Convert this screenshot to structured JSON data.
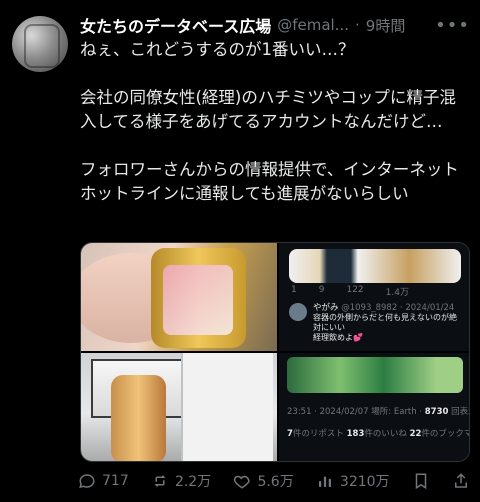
{
  "tweet": {
    "name": "女たちのデータベース広場",
    "handle": "@femal...",
    "dot": "·",
    "time": "9時間",
    "text": "ねぇ、これどうするのが1番いい…？\n\n会社の同僚女性(経理)のハチミツやコップに精子混入してる様子をあげてるアカウントなんだけど…\n\nフォロワーさんからの情報提供で、インターネットホットラインに通報しても進展がないらしい",
    "actions": {
      "replies": "717",
      "retweets": "2.2万",
      "likes": "5.6万",
      "views": "3210万"
    }
  },
  "media": {
    "top_right": {
      "stats": [
        "1",
        "9",
        "122",
        "1.4万"
      ],
      "reply_author": "やがみ",
      "reply_handle_date": "@1093_8982 · 2024/01/24",
      "reply_text": "容器の外側からだと何も見えないのが絶対にいい\n経理飲めよ💕"
    },
    "bottom_right": {
      "line1_prefix": "23:51 · 2024/02/07 場所: Earth · ",
      "line1_bold": "8730",
      "line1_suffix": " 回表示",
      "line2_a": "7",
      "line2_a_label": "件のリポスト ",
      "line2_b": "183",
      "line2_b_label": "件のいいね ",
      "line2_c": "22",
      "line2_c_label": "件のブックマーク"
    }
  },
  "icons": {
    "more": "more-icon",
    "reply": "reply-icon",
    "retweet": "retweet-icon",
    "like": "heart-icon",
    "views": "views-icon",
    "bookmark": "bookmark-icon",
    "share": "share-icon"
  },
  "colors": {
    "background": "#000000",
    "text": "#e7e9ea",
    "muted": "#71767b",
    "border": "#2f3336"
  }
}
